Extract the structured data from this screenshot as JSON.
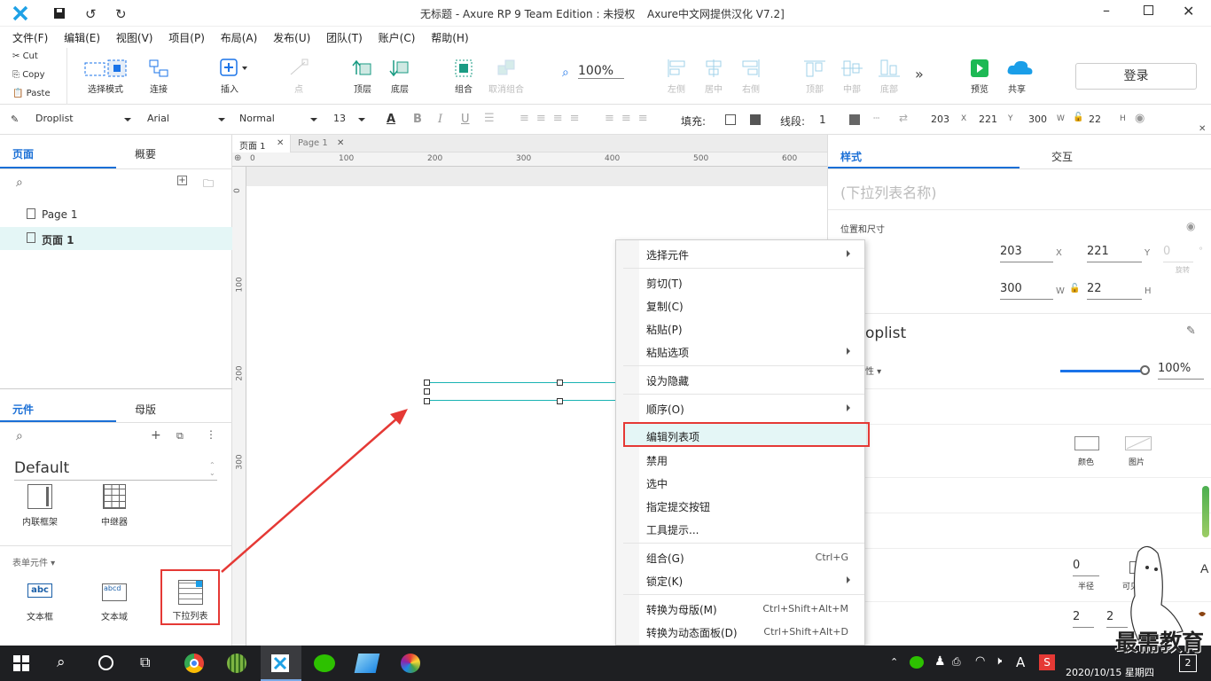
{
  "title_bar": {
    "title": "无标题 - Axure RP 9 Team Edition : 未授权",
    "suffix": "Axure中文网提供汉化 V7.2]"
  },
  "menu": [
    "文件(F)",
    "编辑(E)",
    "视图(V)",
    "项目(P)",
    "布局(A)",
    "发布(U)",
    "团队(T)",
    "账户(C)",
    "帮助(H)"
  ],
  "clipboard": {
    "cut": "Cut",
    "copy": "Copy",
    "paste": "Paste"
  },
  "toolbar": {
    "select_mode": "选择模式",
    "connect": "连接",
    "insert": "插入",
    "point": "点",
    "top_layer": "顶层",
    "bottom_layer": "底层",
    "group": "组合",
    "ungroup": "取消组合",
    "zoom": "100%",
    "align_left": "左侧",
    "align_center": "居中",
    "align_right": "右侧",
    "align_top": "顶部",
    "align_middle": "中部",
    "align_bottom": "底部",
    "preview": "预览",
    "share": "共享",
    "login": "登录"
  },
  "format": {
    "style": "Droplist",
    "font": "Arial",
    "weight": "Normal",
    "size": "13",
    "fill_label": "填充:",
    "line_label": "线段:",
    "line_val": "1",
    "x": "203",
    "x_lbl": "X",
    "y": "221",
    "y_lbl": "Y",
    "w": "300",
    "w_lbl": "W",
    "h": "22",
    "h_lbl": "H"
  },
  "left": {
    "tab_pages": "页面",
    "tab_outline": "概要",
    "pages": [
      "Page 1",
      "页面 1"
    ],
    "tab_widgets": "元件",
    "tab_masters": "母版",
    "library": "Default",
    "widgets_top": [
      "内联框架",
      "中继器"
    ],
    "section": "表单元件 ▾",
    "widgets_form": [
      "文本框",
      "文本域",
      "下拉列表"
    ]
  },
  "doc_tabs": [
    "页面 1",
    "Page 1"
  ],
  "ruler": {
    "h": [
      "0",
      "100",
      "200",
      "300",
      "400",
      "500",
      "600"
    ],
    "v": [
      "0",
      "100",
      "200",
      "300"
    ]
  },
  "right": {
    "tab_style": "样式",
    "tab_interact": "交互",
    "name_placeholder": "(下拉列表名称)",
    "pos_size": "位置和尺寸",
    "x": "203",
    "x_lbl": "X",
    "y": "221",
    "y_lbl": "Y",
    "rot": "0",
    "rot_unit": "°",
    "rot_lbl": "旋转",
    "w": "300",
    "w_lbl": "W",
    "h": "22",
    "h_lbl": "H",
    "style_name": "oplist",
    "opacity_lbl": "性 ▾",
    "opacity": "100%",
    "fill_color": "颜色",
    "fill_image": "图片",
    "radius": "0",
    "radius_lbl": "半径",
    "visible_lbl": "可见性",
    "pad1": "2",
    "pad2": "2"
  },
  "context_menu": {
    "items": [
      {
        "label": "选择元件",
        "sub": true
      },
      {
        "label": "剪切(T)"
      },
      {
        "label": "复制(C)"
      },
      {
        "label": "粘贴(P)"
      },
      {
        "label": "粘贴选项",
        "sub": true
      },
      {
        "label": "设为隐藏"
      },
      {
        "label": "顺序(O)",
        "sub": true
      },
      {
        "label": "编辑列表项",
        "highlight": true
      },
      {
        "label": "禁用"
      },
      {
        "label": "选中"
      },
      {
        "label": "指定提交按钮"
      },
      {
        "label": "工具提示..."
      },
      {
        "label": "组合(G)",
        "shortcut": "Ctrl+G"
      },
      {
        "label": "锁定(K)",
        "sub": true
      },
      {
        "label": "转换为母版(M)",
        "shortcut": "Ctrl+Shift+Alt+M"
      },
      {
        "label": "转换为动态面板(D)",
        "shortcut": "Ctrl+Shift+Alt+D"
      }
    ]
  },
  "watermark": "最需教育",
  "taskbar": {
    "time_label": "",
    "date": "2020/10/15 星期四",
    "badge": "2",
    "ime": "A"
  },
  "colors": {
    "accent": "#1a73e8",
    "highlight": "#e53935",
    "selection": "#1ab3b3",
    "tab_blue": "#1a6fd6"
  }
}
